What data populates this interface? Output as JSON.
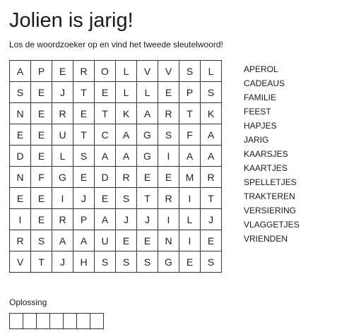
{
  "header": {
    "title": "Jolien is jarig!",
    "instructions": "Los de woordzoeker op en vind het tweede sleutelwoord!"
  },
  "grid": {
    "rows": [
      [
        "A",
        "P",
        "E",
        "R",
        "O",
        "L",
        "V",
        "V",
        "S",
        "L"
      ],
      [
        "S",
        "E",
        "J",
        "T",
        "E",
        "L",
        "L",
        "E",
        "P",
        "S"
      ],
      [
        "N",
        "E",
        "R",
        "E",
        "T",
        "K",
        "A",
        "R",
        "T",
        "K"
      ],
      [
        "E",
        "E",
        "U",
        "T",
        "C",
        "A",
        "G",
        "S",
        "F",
        "A"
      ],
      [
        "D",
        "E",
        "L",
        "S",
        "A",
        "A",
        "G",
        "I",
        "A",
        "A"
      ],
      [
        "N",
        "F",
        "G",
        "E",
        "D",
        "R",
        "E",
        "E",
        "M",
        "R"
      ],
      [
        "E",
        "E",
        "I",
        "J",
        "E",
        "S",
        "T",
        "R",
        "I",
        "T"
      ],
      [
        "I",
        "E",
        "R",
        "P",
        "A",
        "J",
        "J",
        "I",
        "L",
        "J"
      ],
      [
        "R",
        "S",
        "A",
        "A",
        "U",
        "E",
        "E",
        "N",
        "I",
        "E"
      ],
      [
        "V",
        "T",
        "J",
        "H",
        "S",
        "S",
        "S",
        "G",
        "E",
        "S"
      ]
    ]
  },
  "words": [
    "APEROL",
    "CADEAUS",
    "FAMILIE",
    "FEEST",
    "HAPJES",
    "JARIG",
    "KAARSJES",
    "KAARTJES",
    "SPELLETJES",
    "TRAKTEREN",
    "VERSIERING",
    "VLAGGETJES",
    "VRIENDEN"
  ],
  "solution": {
    "label": "Oplossing",
    "box_count": 7
  }
}
